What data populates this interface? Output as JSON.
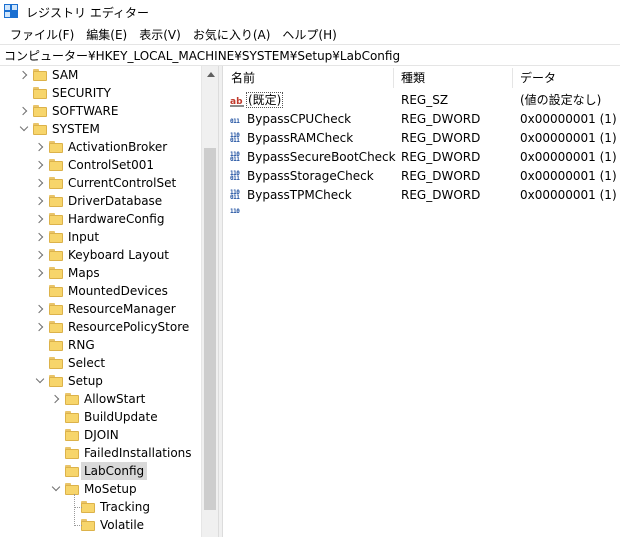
{
  "window": {
    "title": "レジストリ エディター",
    "icon": "regedit-icon"
  },
  "menu": [
    "ファイル(F)",
    "編集(E)",
    "表示(V)",
    "お気に入り(A)",
    "ヘルプ(H)"
  ],
  "address": "コンピューター¥HKEY_LOCAL_MACHINE¥SYSTEM¥Setup¥LabConfig",
  "tree": [
    {
      "label": "SAM",
      "level": 1,
      "expander": "collapsed"
    },
    {
      "label": "SECURITY",
      "level": 1,
      "expander": "none"
    },
    {
      "label": "SOFTWARE",
      "level": 1,
      "expander": "collapsed"
    },
    {
      "label": "SYSTEM",
      "level": 1,
      "expander": "expanded"
    },
    {
      "label": "ActivationBroker",
      "level": 2,
      "expander": "collapsed"
    },
    {
      "label": "ControlSet001",
      "level": 2,
      "expander": "collapsed"
    },
    {
      "label": "CurrentControlSet",
      "level": 2,
      "expander": "collapsed"
    },
    {
      "label": "DriverDatabase",
      "level": 2,
      "expander": "collapsed"
    },
    {
      "label": "HardwareConfig",
      "level": 2,
      "expander": "collapsed"
    },
    {
      "label": "Input",
      "level": 2,
      "expander": "collapsed"
    },
    {
      "label": "Keyboard Layout",
      "level": 2,
      "expander": "collapsed"
    },
    {
      "label": "Maps",
      "level": 2,
      "expander": "collapsed"
    },
    {
      "label": "MountedDevices",
      "level": 2,
      "expander": "none"
    },
    {
      "label": "ResourceManager",
      "level": 2,
      "expander": "collapsed"
    },
    {
      "label": "ResourcePolicyStore",
      "level": 2,
      "expander": "collapsed"
    },
    {
      "label": "RNG",
      "level": 2,
      "expander": "none"
    },
    {
      "label": "Select",
      "level": 2,
      "expander": "none"
    },
    {
      "label": "Setup",
      "level": 2,
      "expander": "expanded"
    },
    {
      "label": "AllowStart",
      "level": 3,
      "expander": "collapsed"
    },
    {
      "label": "BuildUpdate",
      "level": 3,
      "expander": "none"
    },
    {
      "label": "DJOIN",
      "level": 3,
      "expander": "none"
    },
    {
      "label": "FailedInstallations",
      "level": 3,
      "expander": "none"
    },
    {
      "label": "LabConfig",
      "level": 3,
      "expander": "none",
      "selected": true
    },
    {
      "label": "MoSetup",
      "level": 3,
      "expander": "expanded"
    },
    {
      "label": "Tracking",
      "level": 4,
      "expander": "none"
    },
    {
      "label": "Volatile",
      "level": 4,
      "expander": "none"
    }
  ],
  "list": {
    "headers": {
      "name": "名前",
      "type": "種類",
      "data": "データ"
    },
    "rows": [
      {
        "icon": "string-value-icon",
        "name": "(既定)",
        "type": "REG_SZ",
        "data": "(値の設定なし)",
        "is_default": true
      },
      {
        "icon": "binary-value-icon",
        "name": "BypassCPUCheck",
        "type": "REG_DWORD",
        "data": "0x00000001 (1)"
      },
      {
        "icon": "binary-value-icon",
        "name": "BypassRAMCheck",
        "type": "REG_DWORD",
        "data": "0x00000001 (1)"
      },
      {
        "icon": "binary-value-icon",
        "name": "BypassSecureBootCheck",
        "type": "REG_DWORD",
        "data": "0x00000001 (1)"
      },
      {
        "icon": "binary-value-icon",
        "name": "BypassStorageCheck",
        "type": "REG_DWORD",
        "data": "0x00000001 (1)"
      },
      {
        "icon": "binary-value-icon",
        "name": "BypassTPMCheck",
        "type": "REG_DWORD",
        "data": "0x00000001 (1)"
      }
    ]
  },
  "icon_glyphs": {
    "ab": "ab",
    "bin": "011\n110"
  }
}
